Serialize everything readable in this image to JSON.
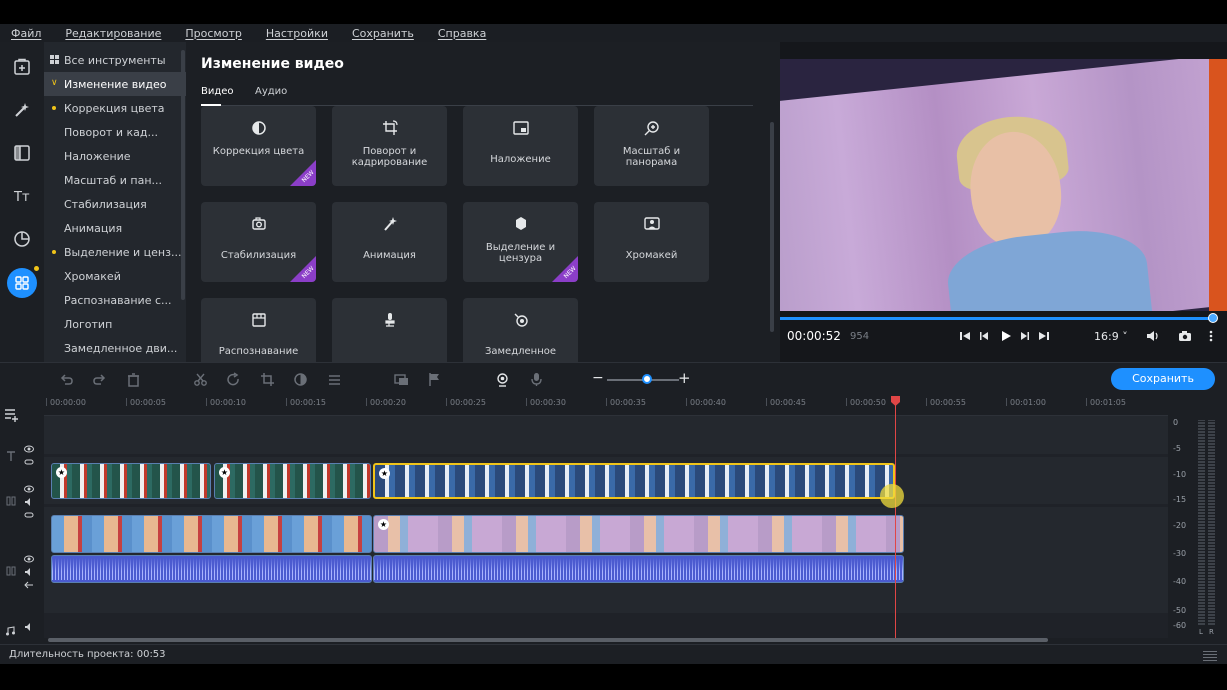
{
  "menu": [
    "Файл",
    "Редактирование",
    "Просмотр",
    "Настройки",
    "Сохранить",
    "Справка"
  ],
  "left_icons": [
    "import-icon",
    "magic-wand-icon",
    "transitions-icon",
    "titles-icon",
    "stickers-icon",
    "more-tools-icon"
  ],
  "tool_list": [
    {
      "label": "Все инструменты",
      "kind": "all"
    },
    {
      "label": "Изменение видео",
      "kind": "expanded",
      "active": true
    },
    {
      "label": "Коррекция цвета",
      "kind": "new"
    },
    {
      "label": "Поворот и кад...",
      "kind": "plain"
    },
    {
      "label": "Наложение",
      "kind": "plain"
    },
    {
      "label": "Масштаб и пан...",
      "kind": "plain"
    },
    {
      "label": "Стабилизация",
      "kind": "plain"
    },
    {
      "label": "Анимация",
      "kind": "plain"
    },
    {
      "label": "Выделение и ценз...",
      "kind": "new"
    },
    {
      "label": "Хромакей",
      "kind": "plain"
    },
    {
      "label": "Распознавание с...",
      "kind": "plain"
    },
    {
      "label": "Логотип",
      "kind": "plain"
    },
    {
      "label": "Замедленное дви...",
      "kind": "plain"
    }
  ],
  "panel": {
    "title": "Изменение видео",
    "tabs": [
      "Видео",
      "Аудио"
    ],
    "cards": [
      {
        "label": "Коррекция цвета",
        "icon": "color-correction-icon",
        "new": true
      },
      {
        "label": "Поворот и кадрирование",
        "icon": "crop-rotate-icon",
        "new": false
      },
      {
        "label": "Наложение",
        "icon": "overlay-icon",
        "new": false
      },
      {
        "label": "Масштаб и панорама",
        "icon": "zoom-pan-icon",
        "new": false
      },
      {
        "label": "Стабилизация",
        "icon": "stabilization-icon",
        "new": true
      },
      {
        "label": "Анимация",
        "icon": "animation-icon",
        "new": false
      },
      {
        "label": "Выделение и цензура",
        "icon": "highlight-censor-icon",
        "new": true
      },
      {
        "label": "Хромакей",
        "icon": "chroma-key-icon",
        "new": false
      },
      {
        "label": "Распознавание",
        "icon": "recognition-icon",
        "new": false
      },
      {
        "label": "",
        "icon": "microphone-stand-icon",
        "new": false
      },
      {
        "label": "Замедленное",
        "icon": "slow-motion-icon",
        "new": false
      }
    ],
    "new_badge": "NEW"
  },
  "player": {
    "timecode": "00:00:52",
    "timecode_ms": "954",
    "aspect": "16:9 ˅",
    "progress": 0.99
  },
  "toolbar": {
    "save_label": "Сохранить",
    "zoom_minus": "−",
    "zoom_plus": "+",
    "zoom_level": 0.55
  },
  "ruler": [
    "00:00:00",
    "00:00:05",
    "00:00:10",
    "00:00:15",
    "00:00:20",
    "00:00:25",
    "00:00:30",
    "00:00:35",
    "00:00:40",
    "00:00:45",
    "00:00:50",
    "00:00:55",
    "00:01:00",
    "00:01:05"
  ],
  "vu_labels": [
    "0",
    "-5",
    "-10",
    "-15",
    "-20",
    "-30",
    "-40",
    "-50",
    "-60"
  ],
  "vu_lr": [
    "L",
    "R"
  ],
  "status": {
    "duration": "Длительность проекта: 00:53"
  },
  "colors": {
    "accent": "#1e90ff",
    "new_badge": "#8b3ec8",
    "playhead": "#e04646",
    "selection": "#f0c419"
  }
}
